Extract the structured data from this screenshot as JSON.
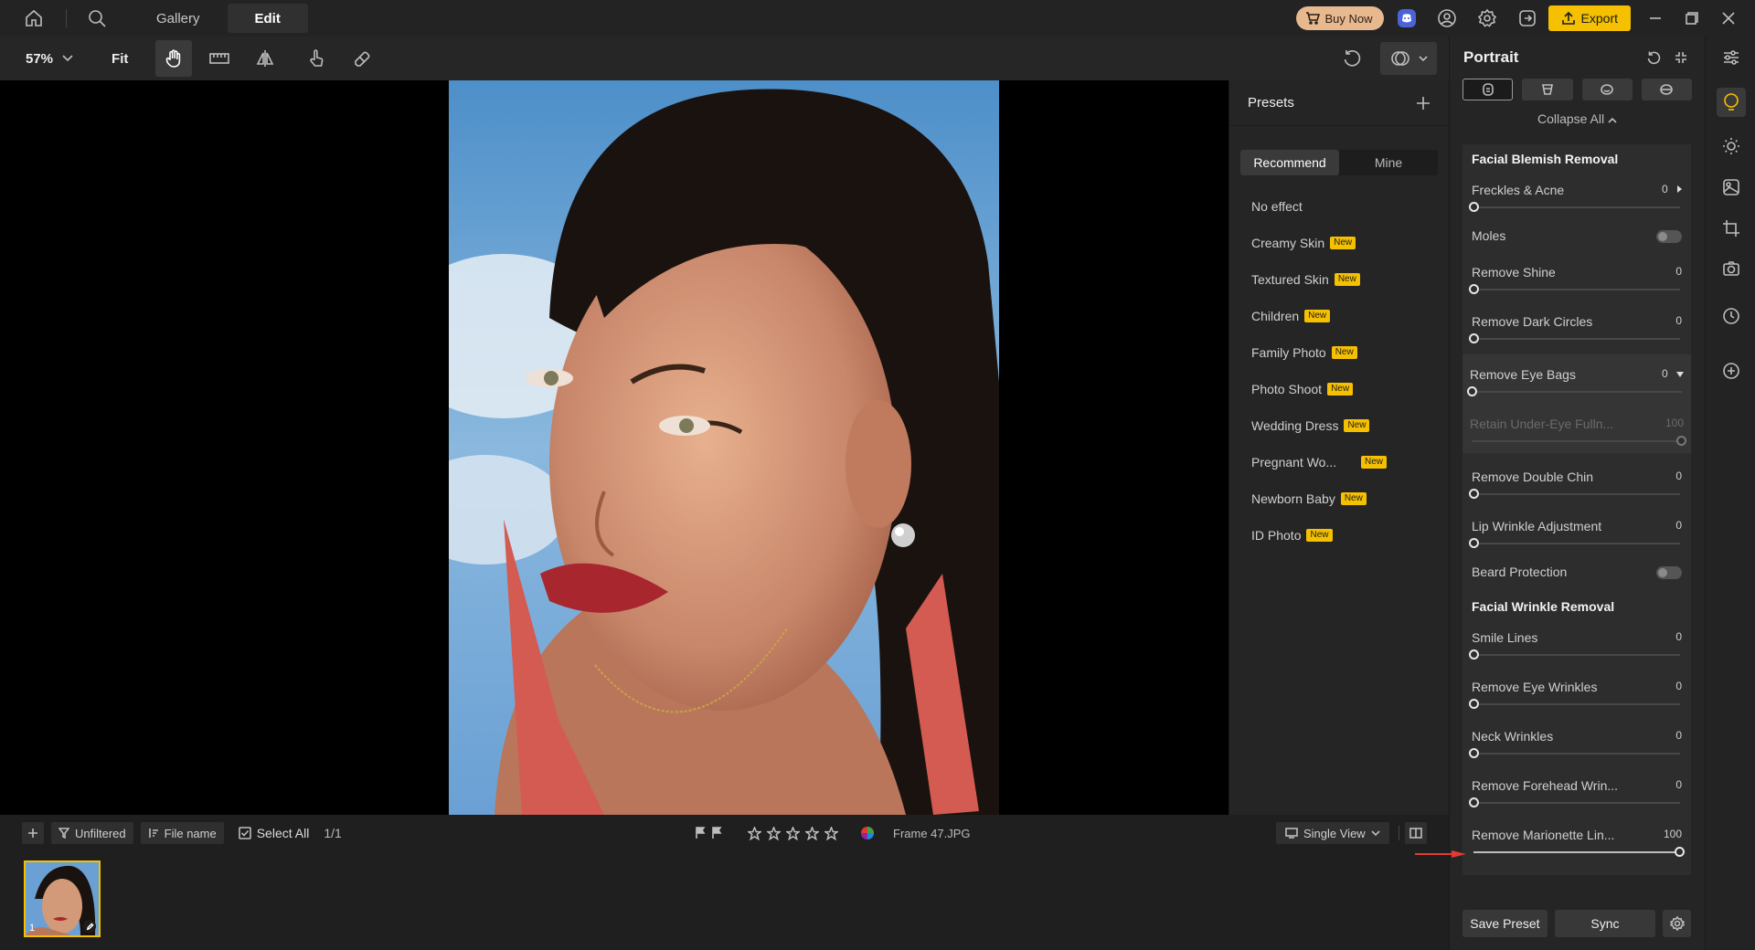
{
  "topbar": {
    "tabs": [
      {
        "label": "Gallery"
      },
      {
        "label": "Edit"
      }
    ],
    "buy_now": "Buy Now",
    "export": "Export"
  },
  "toolbar": {
    "zoom": "57%",
    "fit": "Fit"
  },
  "presets": {
    "title": "Presets",
    "segments": [
      "Recommend",
      "Mine"
    ],
    "new_badge": "New",
    "items": [
      {
        "label": "No effect"
      },
      {
        "label": "Creamy Skin"
      },
      {
        "label": "Textured Skin"
      },
      {
        "label": "Children"
      },
      {
        "label": "Family Photo"
      },
      {
        "label": "Photo Shoot"
      },
      {
        "label": "Wedding Dress"
      },
      {
        "label": "Pregnant Wo..."
      },
      {
        "label": "Newborn Baby"
      },
      {
        "label": "ID Photo"
      }
    ]
  },
  "portrait": {
    "title": "Portrait",
    "collapse_all": "Collapse All",
    "sections": {
      "blemish": "Facial Blemish Removal",
      "wrinkle": "Facial Wrinkle Removal"
    },
    "controls": {
      "freckles": {
        "label": "Freckles & Acne",
        "value": "0"
      },
      "moles": {
        "label": "Moles"
      },
      "shine": {
        "label": "Remove Shine",
        "value": "0"
      },
      "dark_circles": {
        "label": "Remove Dark Circles",
        "value": "0"
      },
      "eye_bags": {
        "label": "Remove Eye Bags",
        "value": "0"
      },
      "under_eye": {
        "label": "Retain Under-Eye Fulln...",
        "value": "100"
      },
      "double_chin": {
        "label": "Remove Double Chin",
        "value": "0"
      },
      "lip_wrinkle": {
        "label": "Lip Wrinkle Adjustment",
        "value": "0"
      },
      "beard": {
        "label": "Beard Protection"
      },
      "smile_lines": {
        "label": "Smile Lines",
        "value": "0"
      },
      "eye_wrinkles": {
        "label": "Remove Eye Wrinkles",
        "value": "0"
      },
      "neck": {
        "label": "Neck Wrinkles",
        "value": "0"
      },
      "forehead": {
        "label": "Remove Forehead Wrin...",
        "value": "0"
      },
      "marionette": {
        "label": "Remove Marionette Lin...",
        "value": "100"
      }
    },
    "save_preset": "Save Preset",
    "sync": "Sync"
  },
  "filmbar": {
    "unfiltered": "Unfiltered",
    "file_name": "File name",
    "select_all": "Select All",
    "count": "1/1",
    "filename": "Frame 47.JPG",
    "single_view": "Single View"
  },
  "thumb": {
    "index": "1"
  }
}
